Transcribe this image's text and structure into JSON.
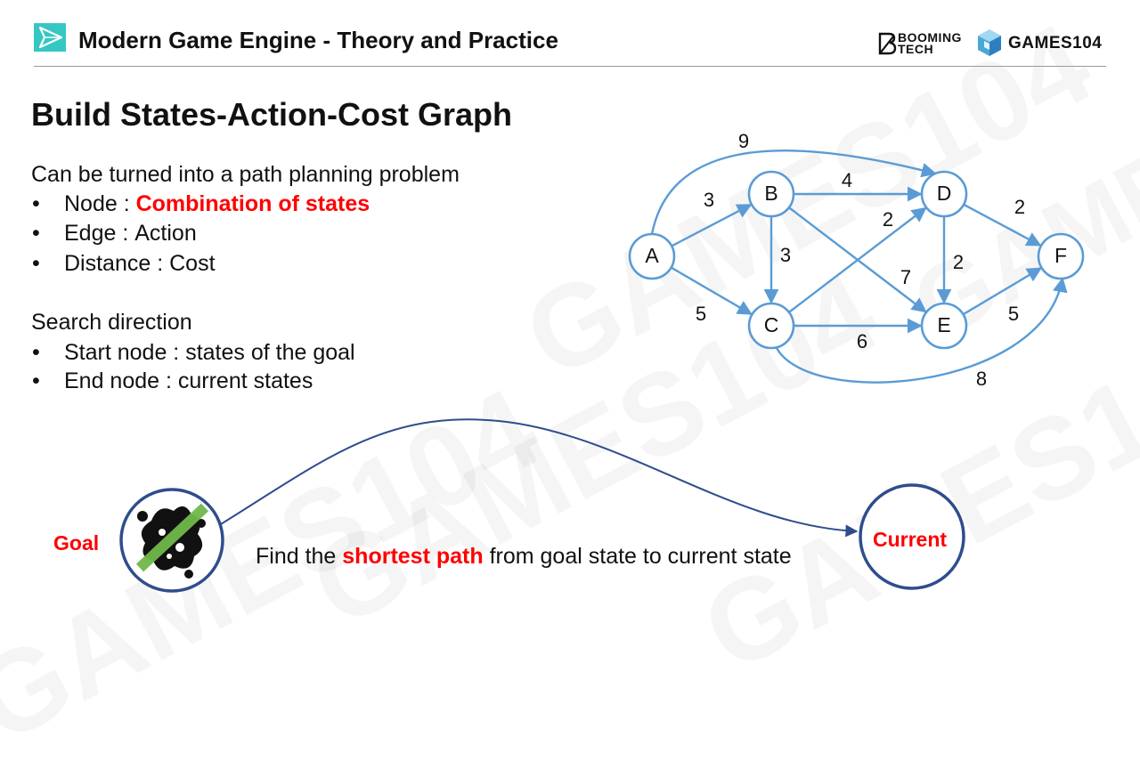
{
  "header": {
    "title": "Modern Game Engine - Theory and Practice",
    "brand_tech_line1": "BOOMING",
    "brand_tech_line2": "TECH",
    "brand_games": "GAMES104"
  },
  "slide": {
    "title": "Build States-Action-Cost Graph",
    "intro": "Can be turned into a path planning problem",
    "bullets1": [
      {
        "label": "Node : ",
        "value": "Combination of states"
      },
      {
        "label": "Edge : ",
        "value": "Action"
      },
      {
        "label": "Distance : ",
        "value": "Cost"
      }
    ],
    "search_heading": "Search direction",
    "bullets2": [
      "Start node : states of  the goal",
      "End node : current states"
    ],
    "bullet_char": "•"
  },
  "graph": {
    "nodes": [
      "A",
      "B",
      "C",
      "D",
      "E",
      "F"
    ],
    "edges": [
      {
        "from": "A",
        "to": "B",
        "cost": "3"
      },
      {
        "from": "A",
        "to": "C",
        "cost": "5"
      },
      {
        "from": "A",
        "to": "D",
        "cost": "9"
      },
      {
        "from": "B",
        "to": "D",
        "cost": "4"
      },
      {
        "from": "B",
        "to": "C",
        "cost": "3"
      },
      {
        "from": "B",
        "to": "E",
        "cost": "7"
      },
      {
        "from": "C",
        "to": "D",
        "cost": "2"
      },
      {
        "from": "C",
        "to": "E",
        "cost": "6"
      },
      {
        "from": "C",
        "to": "F",
        "cost": "8"
      },
      {
        "from": "D",
        "to": "E",
        "cost": "2"
      },
      {
        "from": "D",
        "to": "F",
        "cost": "2"
      },
      {
        "from": "E",
        "to": "F",
        "cost": "5"
      }
    ],
    "edge_color": "#5b9bd5"
  },
  "bottom": {
    "goal_label": "Goal",
    "current_label": "Current",
    "find_prefix": "Find the ",
    "find_highlight": "shortest path",
    "find_suffix": " from goal state to current state",
    "circle_color": "#2f4d8c",
    "accent_red": "#ff0000",
    "goal_icon": "crossed-out-blob-icon"
  },
  "watermark": "GAMES104"
}
